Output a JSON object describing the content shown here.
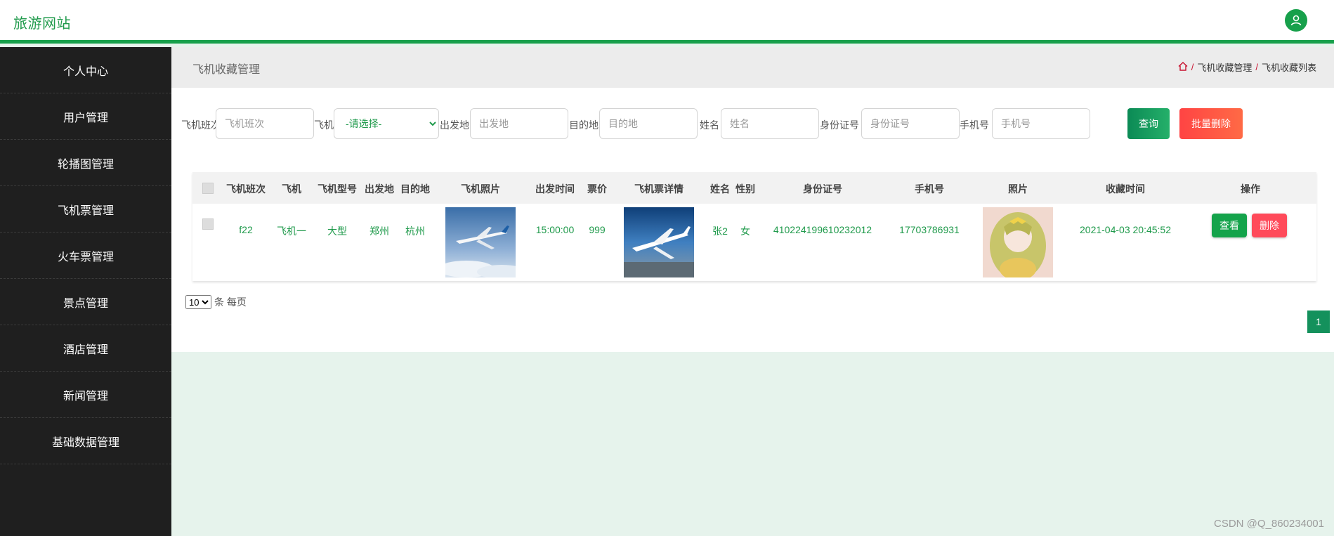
{
  "app": {
    "title": "旅游网站"
  },
  "sidebar": {
    "items": [
      {
        "label": "个人中心"
      },
      {
        "label": "用户管理"
      },
      {
        "label": "轮播图管理"
      },
      {
        "label": "飞机票管理"
      },
      {
        "label": "火车票管理"
      },
      {
        "label": "景点管理"
      },
      {
        "label": "酒店管理"
      },
      {
        "label": "新闻管理"
      },
      {
        "label": "基础数据管理"
      }
    ]
  },
  "page": {
    "title": "飞机收藏管理",
    "breadcrumb": [
      "飞机收藏管理",
      "飞机收藏列表"
    ]
  },
  "search": {
    "flight_no_label": "飞机班次",
    "flight_no_placeholder": "飞机班次",
    "plane_label": "飞机",
    "plane_selected": "-请选择-",
    "from_label": "出发地",
    "from_placeholder": "出发地",
    "to_label": "目的地",
    "to_placeholder": "目的地",
    "name_label": "姓名",
    "name_placeholder": "姓名",
    "idcard_label": "身份证号",
    "idcard_placeholder": "身份证号",
    "phone_label": "手机号",
    "phone_placeholder": "手机号",
    "query_label": "查询",
    "batch_delete_label": "批量删除"
  },
  "table": {
    "headers": [
      "飞机班次",
      "飞机",
      "飞机型号",
      "出发地",
      "目的地",
      "飞机照片",
      "出发时间",
      "票价",
      "飞机票详情",
      "姓名",
      "性别",
      "身份证号",
      "手机号",
      "照片",
      "收藏时间",
      "操作"
    ],
    "rows": [
      {
        "flight_no": "f22",
        "plane": "飞机一",
        "model": "大型",
        "from": "郑州",
        "to": "杭州",
        "depart_time": "15:00:00",
        "price": "999",
        "name": "张2",
        "gender": "女",
        "idcard": "410224199610232012",
        "phone": "17703786931",
        "fav_time": "2021-04-03 20:45:52",
        "view_label": "查看",
        "delete_label": "删除"
      }
    ]
  },
  "pagination": {
    "page_size": "10",
    "page_size_suffix": "条 每页",
    "current_page": "1"
  },
  "watermark": "CSDN @Q_860234001",
  "colors": {
    "brand_green": "#17a04b",
    "sidebar_bg": "#1f1f1f",
    "danger": "#ff4444"
  }
}
